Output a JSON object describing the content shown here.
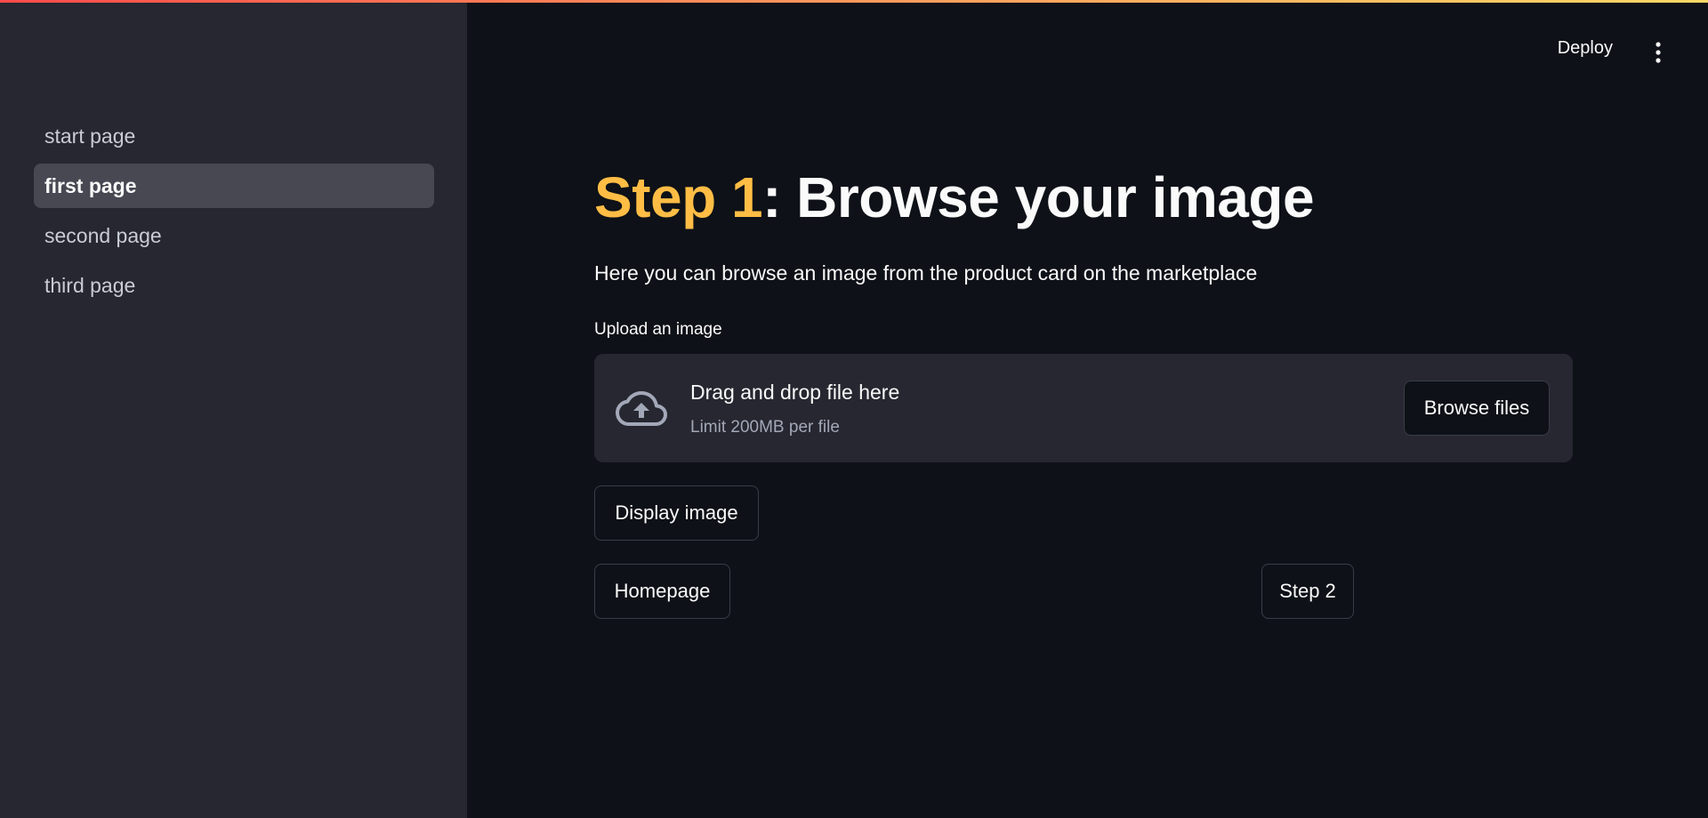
{
  "sidebar": {
    "items": [
      {
        "label": "start page"
      },
      {
        "label": "first page"
      },
      {
        "label": "second page"
      },
      {
        "label": "third page"
      }
    ],
    "active_index": 1
  },
  "header": {
    "deploy_label": "Deploy",
    "menu_icon": "kebab-menu-icon"
  },
  "main": {
    "title_accent": "Step 1",
    "title_rest": ": Browse your image",
    "description": "Here you can browse an image from the product card on the marketplace",
    "uploader": {
      "label": "Upload an image",
      "icon": "cloud-upload-icon",
      "drop_text": "Drag and drop file here",
      "limit_text": "Limit 200MB per file",
      "browse_label": "Browse files"
    },
    "buttons": {
      "display": "Display image",
      "homepage": "Homepage",
      "step2": "Step 2"
    }
  },
  "colors": {
    "accent": "#ffbd45",
    "background": "#0e1117",
    "sidebar": "#262730"
  }
}
